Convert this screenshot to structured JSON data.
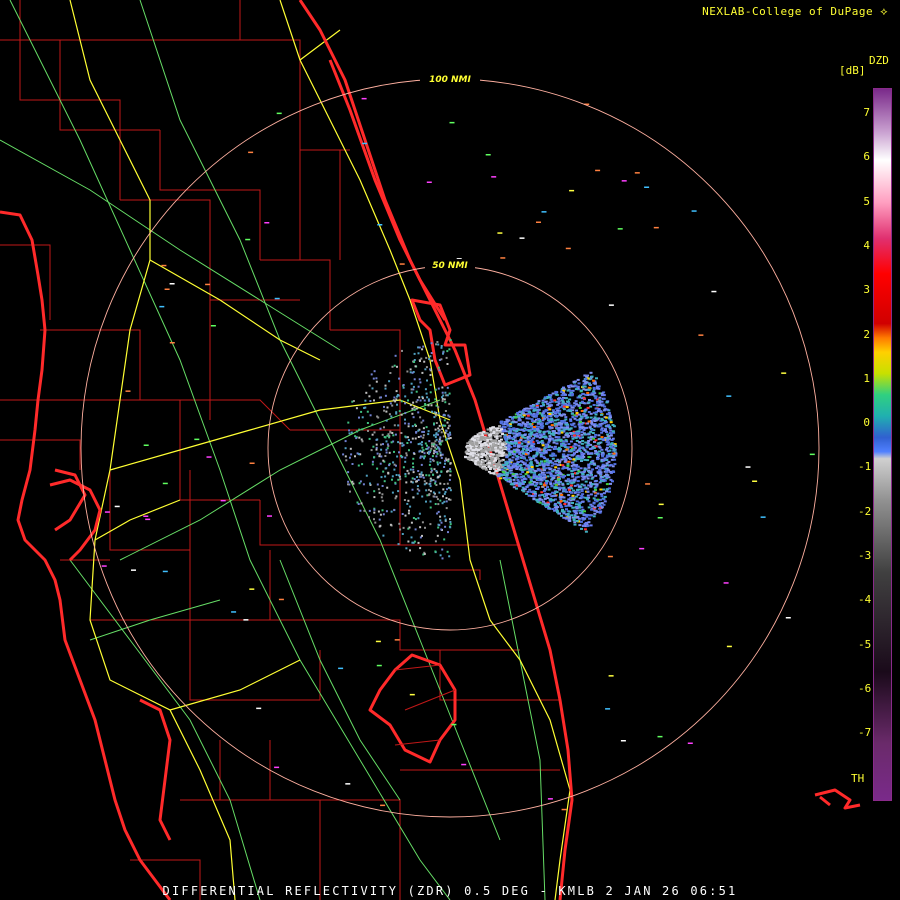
{
  "header": {
    "credit": "NEXLAB-College of DuPage",
    "credit_logo_icon": "nexlab-mark-icon"
  },
  "footer": {
    "caption": "DIFFERENTIAL REFLECTIVITY (ZDR) 0.5 DEG - KMLB 2 JAN 26 06:51"
  },
  "range_rings": {
    "inner_label": "50 NMI",
    "outer_label": "100 NMI"
  },
  "colorbar": {
    "product": "DZD",
    "units": "[dB]",
    "ticks": [
      "7",
      "6",
      "5",
      "4",
      "3",
      "2",
      "1",
      "0",
      "-1",
      "-2",
      "-3",
      "-4",
      "-5",
      "-6",
      "-7"
    ],
    "bottom_label": "TH",
    "min": -8,
    "max": 7.5
  },
  "colors": {
    "state_lines": "#ff2a2a",
    "county_lines": "#c01818",
    "highways": "#ffff33",
    "roads": "#66dd66",
    "range_rings": "#ffb0a0",
    "labels": "#ffff33"
  }
}
